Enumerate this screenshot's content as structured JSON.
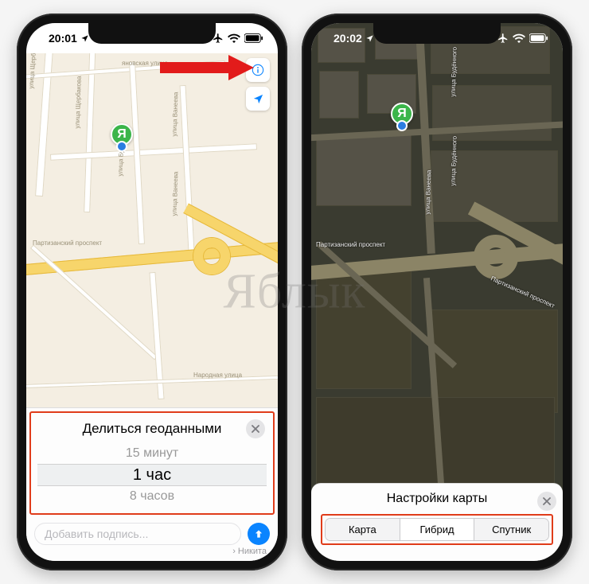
{
  "watermark": "Яблык",
  "left": {
    "status": {
      "time": "20:01",
      "icons": [
        "location-arrow-icon",
        "airplane-icon",
        "wifi-icon",
        "battery-icon"
      ]
    },
    "map": {
      "streets": [
        "улица Щербакова",
        "улица Щербакова",
        "яновская улица",
        "улица Будённого",
        "улица Ванеева",
        "улица Ванеева",
        "Партизанский проспект",
        "Народная улица"
      ],
      "pin_label": "Я"
    },
    "sheet": {
      "title": "Делиться геоданными",
      "options": [
        "15 минут",
        "1 час",
        "8 часов"
      ],
      "selected_index": 1
    },
    "compose": {
      "placeholder": "Добавить подпись...",
      "recipient_prefix": "›",
      "recipient": "Никита"
    }
  },
  "right": {
    "status": {
      "time": "20:02",
      "icons": [
        "location-arrow-icon",
        "airplane-icon",
        "wifi-icon",
        "battery-icon"
      ]
    },
    "map": {
      "streets": [
        "улица Будённого",
        "улица Будённого",
        "улица Ванеева",
        "Партизанский проспект",
        "Партизанский проспект"
      ],
      "pin_label": "Я"
    },
    "sheet": {
      "title": "Настройки карты",
      "segments": [
        "Карта",
        "Гибрид",
        "Спутник"
      ],
      "selected_index": 1
    }
  }
}
